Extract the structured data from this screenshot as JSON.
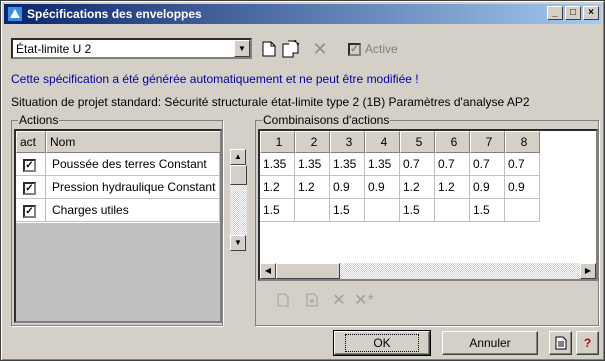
{
  "window": {
    "title": "Spécifications des enveloppes"
  },
  "selector": {
    "value": "État-limite U 2"
  },
  "active": {
    "label": "Active",
    "checked": true,
    "enabled": false
  },
  "info": {
    "message": "Cette spécification a été générée automatiquement et ne peut être modifiée !",
    "situation": "Situation de projet standard: Sécurité structurale état-limite type 2 (1B)  Paramètres d'analyse AP2"
  },
  "actions": {
    "group_label": "Actions",
    "headers": {
      "act": "act",
      "name": "Nom"
    },
    "rows": [
      {
        "checked": true,
        "name": "Poussée des terres Constant"
      },
      {
        "checked": true,
        "name": "Pression hydraulique Constant"
      },
      {
        "checked": true,
        "name": "Charges utiles"
      }
    ]
  },
  "combinations": {
    "group_label": "Combinaisons d'actions",
    "headers": [
      "1",
      "2",
      "3",
      "4",
      "5",
      "6",
      "7",
      "8"
    ],
    "rows": [
      [
        "1.35",
        "1.35",
        "1.35",
        "1.35",
        "0.7",
        "0.7",
        "0.7",
        "0.7"
      ],
      [
        "1.2",
        "1.2",
        "0.9",
        "0.9",
        "1.2",
        "1.2",
        "0.9",
        "0.9"
      ],
      [
        "1.5",
        "",
        "1.5",
        "",
        "1.5",
        "",
        "1.5",
        ""
      ]
    ]
  },
  "buttons": {
    "ok": "OK",
    "cancel": "Annuler",
    "help_glyph": "?"
  },
  "colors": {
    "title_gradient_start": "#0a246a",
    "title_gradient_end": "#a6caf0",
    "info_text": "#0000a0",
    "help": "#c00000"
  }
}
